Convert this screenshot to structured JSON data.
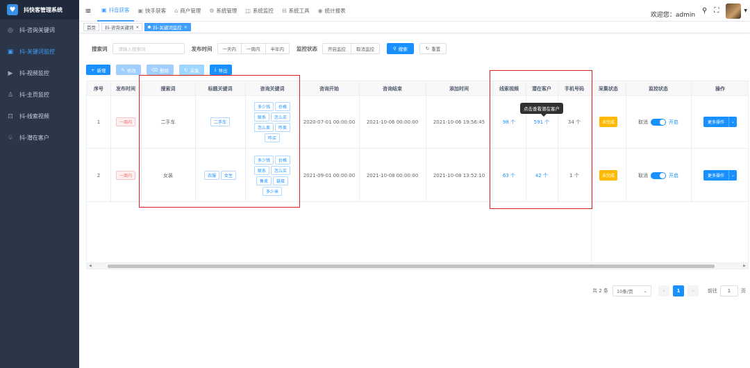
{
  "app": {
    "title": "抖快客管理系统"
  },
  "sidebar": {
    "items": [
      {
        "label": "抖-咨询关键词",
        "icon": "search-icon",
        "glyph": "◎"
      },
      {
        "label": "抖-关键词监控",
        "icon": "monitor-icon",
        "glyph": "▣"
      },
      {
        "label": "抖-视频监控",
        "icon": "video-icon",
        "glyph": "▶"
      },
      {
        "label": "抖-主页监控",
        "icon": "user-icon",
        "glyph": "♙"
      },
      {
        "label": "抖-线索视频",
        "icon": "clue-video-icon",
        "glyph": "⊡"
      },
      {
        "label": "抖-潜在客户",
        "icon": "customer-icon",
        "glyph": "♧"
      }
    ]
  },
  "topnav": {
    "items": [
      {
        "label": "抖音获客",
        "glyph": "▣"
      },
      {
        "label": "快手获客",
        "glyph": "▣"
      },
      {
        "label": "商户管理",
        "glyph": "⌂"
      },
      {
        "label": "系统管理",
        "glyph": "⚙"
      },
      {
        "label": "系统监控",
        "glyph": "◫"
      },
      {
        "label": "系统工具",
        "glyph": "⊟"
      },
      {
        "label": "统计报表",
        "glyph": "◉"
      }
    ],
    "welcome": "欢迎您：admin"
  },
  "tags": {
    "home": "首页",
    "tab1": "抖-咨询关键词",
    "tab2": "抖-关键词监控"
  },
  "search": {
    "keyword_label": "搜索词",
    "keyword_placeholder": "请输入搜索词",
    "time_label": "发布时间",
    "time_options": [
      "一天内",
      "一周内",
      "半年内"
    ],
    "status_label": "监控状态",
    "status_options": [
      "开启监控",
      "取消监控"
    ],
    "search_btn": "搜索",
    "reset_btn": "重置"
  },
  "actions": {
    "add": "新增",
    "edit": "修改",
    "delete": "删除",
    "collect": "采集",
    "export": "导出"
  },
  "table": {
    "headers": {
      "index": "序号",
      "publish_time": "发布时间",
      "search_word": "搜索词",
      "title_kw": "标题关键词",
      "consult_kw": "咨询关键词",
      "consult_start": "咨询开始",
      "consult_end": "咨询结束",
      "added_time": "添加时间",
      "clue_video": "线索视频",
      "potential": "潜在客户",
      "phone": "手机号码",
      "collect_status": "采集状态",
      "monitor_status": "监控状态",
      "operation": "操作"
    },
    "rows": [
      {
        "index": "1",
        "publish_time": "一周内",
        "search_word": "二手车",
        "title_kw": [
          "二手车"
        ],
        "consult_kw": [
          "多少钱",
          "价格",
          "联系",
          "怎么买",
          "怎么卖",
          "咋卖",
          "咋买"
        ],
        "consult_start": "2020-07-01 00:00:00",
        "consult_end": "2021-10-06 00:00:00",
        "added_time": "2021-10-06 19:56:45",
        "clue_video": "98 个",
        "potential": "591 个",
        "phone": "34 个",
        "collect_status": "未完成",
        "monitor_off": "取消",
        "monitor_on": "开启",
        "operation": "更多操作"
      },
      {
        "index": "2",
        "publish_time": "一周内",
        "search_word": "女装",
        "title_kw": [
          "衣服",
          "女生"
        ],
        "consult_kw": [
          "多少钱",
          "价格",
          "联系",
          "怎么买",
          "售卖",
          "链接",
          "多少米"
        ],
        "consult_start": "2021-09-01 00:00:00",
        "consult_end": "2021-10-08 00:00:00",
        "added_time": "2021-10-08 13:52:10",
        "clue_video": "63 个",
        "potential": "42 个",
        "phone": "1 个",
        "collect_status": "未完成",
        "monitor_off": "取消",
        "monitor_on": "开启",
        "operation": "更多操作"
      }
    ],
    "tooltip": "点击查看潜在客户"
  },
  "pagination": {
    "total": "共 2 条",
    "page_size": "10条/页",
    "current_page": "1",
    "goto_label": "前往",
    "goto_value": "1",
    "page_suffix": "页"
  },
  "colors": {
    "primary": "#1890ff",
    "sidebar": "#2b3649",
    "highlight_box": "#e02020"
  }
}
